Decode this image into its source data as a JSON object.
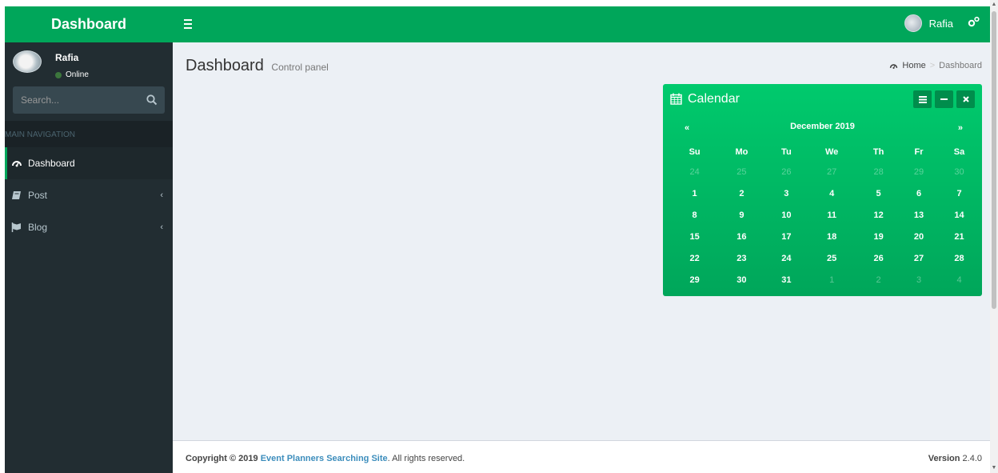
{
  "header": {
    "logo": "Dashboard",
    "user_name": "Rafia"
  },
  "sidebar": {
    "user": {
      "name": "Rafia",
      "status": "Online"
    },
    "search": {
      "placeholder": "Search..."
    },
    "nav_header": "MAIN NAVIGATION",
    "items": [
      {
        "label": "Dashboard",
        "icon": "dashboard-icon",
        "active": true
      },
      {
        "label": "Post",
        "icon": "book-icon",
        "active": false
      },
      {
        "label": "Blog",
        "icon": "flag-icon",
        "active": false
      }
    ]
  },
  "content": {
    "title": "Dashboard",
    "subtitle": "Control panel",
    "breadcrumb": {
      "home": "Home",
      "separator": ">",
      "current": "Dashboard"
    }
  },
  "calendar": {
    "title": "Calendar",
    "month": "December 2019",
    "prev": "«",
    "next": "»",
    "weekdays": [
      "Su",
      "Mo",
      "Tu",
      "We",
      "Th",
      "Fr",
      "Sa"
    ],
    "weeks": [
      [
        [
          "24",
          true
        ],
        [
          "25",
          true
        ],
        [
          "26",
          true
        ],
        [
          "27",
          true
        ],
        [
          "28",
          true
        ],
        [
          "29",
          true
        ],
        [
          "30",
          true
        ]
      ],
      [
        [
          "1",
          false
        ],
        [
          "2",
          false
        ],
        [
          "3",
          false
        ],
        [
          "4",
          false
        ],
        [
          "5",
          false
        ],
        [
          "6",
          false
        ],
        [
          "7",
          false
        ]
      ],
      [
        [
          "8",
          false
        ],
        [
          "9",
          false
        ],
        [
          "10",
          false
        ],
        [
          "11",
          false
        ],
        [
          "12",
          false
        ],
        [
          "13",
          false
        ],
        [
          "14",
          false
        ]
      ],
      [
        [
          "15",
          false
        ],
        [
          "16",
          false
        ],
        [
          "17",
          false
        ],
        [
          "18",
          false
        ],
        [
          "19",
          false
        ],
        [
          "20",
          false
        ],
        [
          "21",
          false
        ]
      ],
      [
        [
          "22",
          false
        ],
        [
          "23",
          false
        ],
        [
          "24",
          false
        ],
        [
          "25",
          false
        ],
        [
          "26",
          false
        ],
        [
          "27",
          false
        ],
        [
          "28",
          false
        ]
      ],
      [
        [
          "29",
          false
        ],
        [
          "30",
          false
        ],
        [
          "31",
          false
        ],
        [
          "1",
          true
        ],
        [
          "2",
          true
        ],
        [
          "3",
          true
        ],
        [
          "4",
          true
        ]
      ]
    ]
  },
  "footer": {
    "copyright_prefix": "Copyright © 2019 ",
    "site_name": "Event Planners Searching Site",
    "suffix": ". All rights reserved.",
    "version_label": "Version",
    "version": "2.4.0"
  },
  "colors": {
    "brand_green": "#00a65a",
    "sidebar_bg": "#222d32",
    "link_blue": "#3c8dbc"
  }
}
